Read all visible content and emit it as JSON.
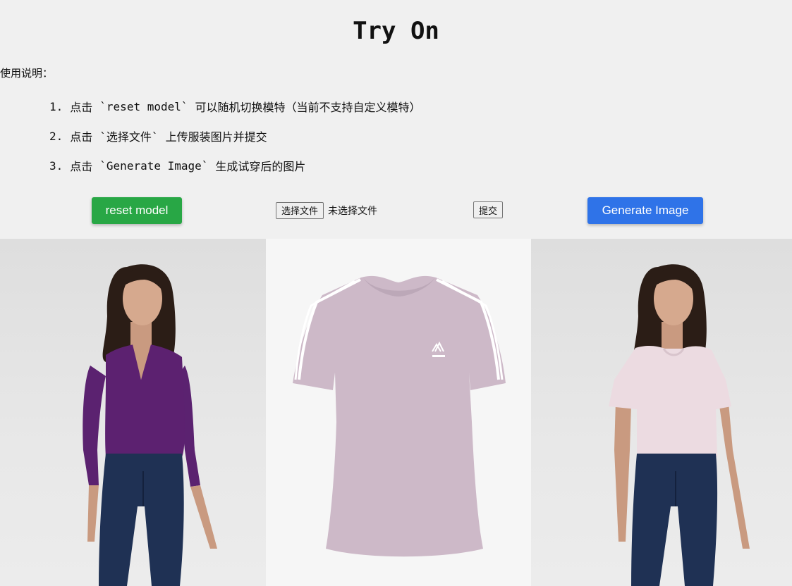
{
  "page": {
    "title": "Try On"
  },
  "instructions": {
    "heading": "使用说明：",
    "steps": [
      {
        "num": "1.",
        "prefix": "点击",
        "code": "`reset model`",
        "text": "可以随机切换模特（当前不支持自定义模特）"
      },
      {
        "num": "2.",
        "prefix": "点击",
        "code": "`选择文件`",
        "text": "上传服装图片并提交"
      },
      {
        "num": "3.",
        "prefix": "点击",
        "code": "`Generate Image`",
        "text": "生成试穿后的图片"
      }
    ]
  },
  "controls": {
    "reset_label": "reset model",
    "choose_file_label": "选择文件",
    "file_status": "未选择文件",
    "submit_label": "提交",
    "generate_label": "Generate Image"
  },
  "colors": {
    "reset_button": "#28a745",
    "generate_button": "#2f73e8",
    "page_background": "#f0f0f0"
  }
}
